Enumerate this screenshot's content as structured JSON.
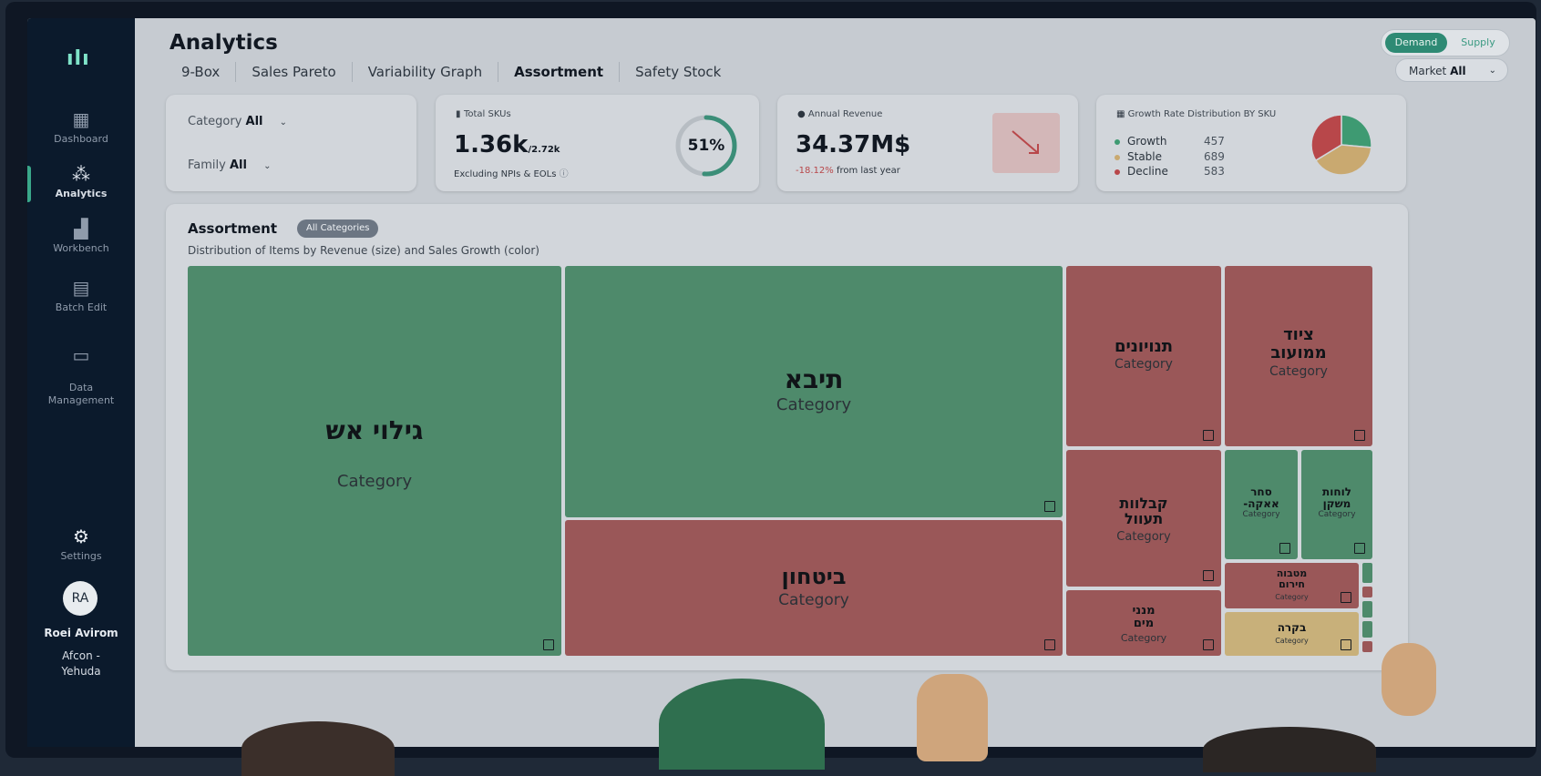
{
  "sidebar": {
    "items": [
      {
        "label": "Dashboard",
        "icon": "grid-icon"
      },
      {
        "label": "Analytics",
        "icon": "analytics-icon"
      },
      {
        "label": "Workbench",
        "icon": "chart-icon"
      },
      {
        "label": "Batch Edit",
        "icon": "table-icon"
      },
      {
        "label": "Data\nManagement",
        "icon": "folder-icon"
      }
    ],
    "settings": "Settings",
    "user_initials": "RA",
    "user_name": "Roei Avirom",
    "user_org": "Afcon -\nYehuda"
  },
  "header": {
    "title": "Analytics",
    "tabs": [
      "9-Box",
      "Sales Pareto",
      "Variability Graph",
      "Assortment",
      "Safety Stock"
    ],
    "active_tab": "Assortment",
    "toggle": {
      "on": "Demand",
      "off": "Supply"
    },
    "market_label": "Market",
    "market_value": "All"
  },
  "filters": {
    "category_label": "Category",
    "category_value": "All",
    "family_label": "Family",
    "family_value": "All"
  },
  "total_skus": {
    "label": "Total SKUs",
    "value": "1.36k",
    "of_total": "/2.72k",
    "note": "Excluding NPIs & EOLs",
    "percent": "51%",
    "ratio": 0.51
  },
  "annual_revenue": {
    "label": "Annual Revenue",
    "value": "34.37M$",
    "change": "-18.12%",
    "change_note": "from last year"
  },
  "growth_distribution": {
    "label": "Growth Rate Distribution BY SKU",
    "rows": [
      {
        "name": "Growth",
        "count": "457",
        "color": "#3e9a72"
      },
      {
        "name": "Stable",
        "count": "689",
        "color": "#c9a970"
      },
      {
        "name": "Decline",
        "count": "583",
        "color": "#b8474a"
      }
    ]
  },
  "assortment": {
    "title": "Assortment",
    "chip": "All Categories",
    "subtitle": "Distribution of Items by Revenue (size) and Sales Growth (color)",
    "tiles": [
      {
        "name": "גילוי אש",
        "sub": "Category"
      },
      {
        "name": "תיבא",
        "sub": "Category"
      },
      {
        "name": "ביטחון",
        "sub": "Category"
      },
      {
        "name": "תנויונים",
        "sub": "Category"
      },
      {
        "name": "ציוד ממועוב",
        "sub": "Category"
      },
      {
        "name": "קבלוות תעוול",
        "sub": "Category"
      },
      {
        "name": "סחר אאקה-",
        "sub": "Category"
      },
      {
        "name": "לוחות משקן",
        "sub": "Category"
      },
      {
        "name": "מנני מים",
        "sub": "Category"
      },
      {
        "name": "מטבוה חירום",
        "sub": "Category"
      },
      {
        "name": "בקרה",
        "sub": "Category"
      }
    ]
  },
  "colors": {
    "growth": "#4e8a6b",
    "decline": "#9a5758",
    "stable": "#c8b07a",
    "accent": "#2e8a74"
  }
}
